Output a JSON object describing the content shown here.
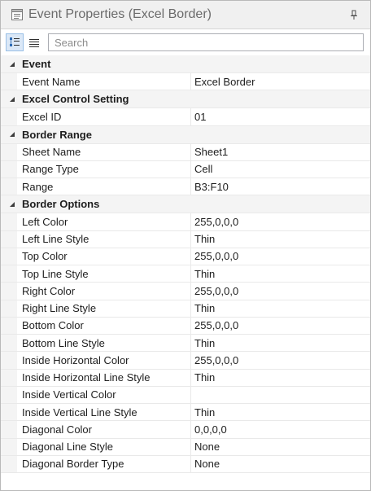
{
  "window": {
    "title": "Event Properties (Excel Border)"
  },
  "toolbar": {
    "search_placeholder": "Search"
  },
  "categories": [
    {
      "label": "Event",
      "properties": [
        {
          "name": "Event Name",
          "value": "Excel Border"
        }
      ]
    },
    {
      "label": "Excel Control Setting",
      "properties": [
        {
          "name": "Excel ID",
          "value": "01"
        }
      ]
    },
    {
      "label": "Border Range",
      "properties": [
        {
          "name": "Sheet Name",
          "value": "Sheet1"
        },
        {
          "name": "Range Type",
          "value": "Cell"
        },
        {
          "name": "Range",
          "value": "B3:F10"
        }
      ]
    },
    {
      "label": "Border Options",
      "properties": [
        {
          "name": "Left Color",
          "value": "255,0,0,0"
        },
        {
          "name": "Left Line Style",
          "value": "Thin"
        },
        {
          "name": "Top Color",
          "value": "255,0,0,0"
        },
        {
          "name": "Top Line Style",
          "value": "Thin"
        },
        {
          "name": "Right Color",
          "value": "255,0,0,0"
        },
        {
          "name": "Right Line Style",
          "value": "Thin"
        },
        {
          "name": "Bottom Color",
          "value": "255,0,0,0"
        },
        {
          "name": "Bottom Line Style",
          "value": "Thin"
        },
        {
          "name": "Inside Horizontal Color",
          "value": "255,0,0,0"
        },
        {
          "name": "Inside Horizontal Line Style",
          "value": "Thin"
        },
        {
          "name": "Inside Vertical Color",
          "value": ""
        },
        {
          "name": "Inside Vertical Line Style",
          "value": "Thin"
        },
        {
          "name": "Diagonal Color",
          "value": "0,0,0,0"
        },
        {
          "name": "Diagonal Line Style",
          "value": "None"
        },
        {
          "name": "Diagonal Border Type",
          "value": "None"
        }
      ]
    }
  ],
  "icons": {
    "title": "properties-window-icon",
    "pin": "pin-icon",
    "categorized": "categorized-view-icon",
    "alphabetical": "alphabetical-view-icon",
    "collapse": "collapse-triangle-icon"
  },
  "colors": {
    "category_background": "#f4f4f4",
    "active_button": "#dbe8f7",
    "grid_line": "#e9e9e9"
  }
}
